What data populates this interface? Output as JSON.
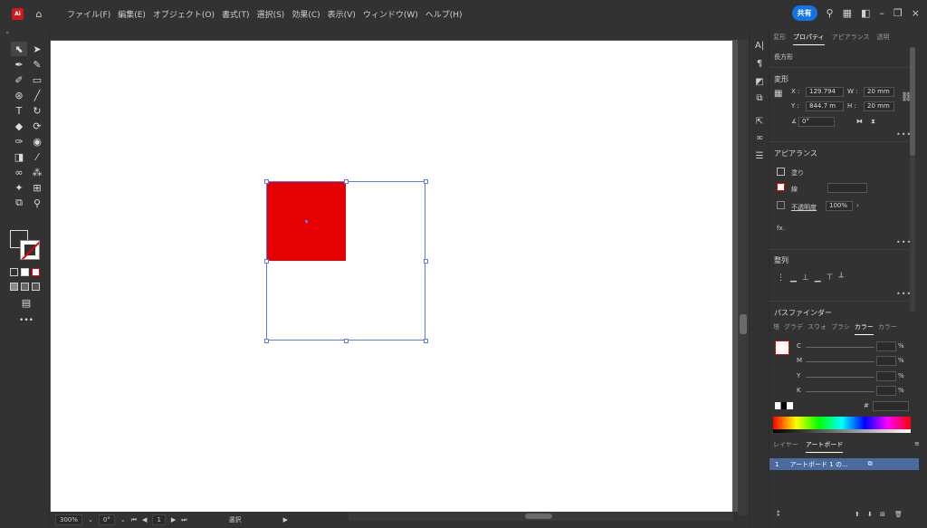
{
  "menu": {
    "logo": "Ai",
    "items": [
      "ファイル(F)",
      "編集(E)",
      "オブジェクト(O)",
      "書式(T)",
      "選択(S)",
      "効果(C)",
      "表示(V)",
      "ウィンドウ(W)",
      "ヘルプ(H)"
    ],
    "share_label": "共有"
  },
  "statusbar": {
    "zoom": "300%",
    "rotation": "0°",
    "artboard_index": "1",
    "tool_name": "選択"
  },
  "panel": {
    "tabs": [
      "変形",
      "プロパティ",
      "アピアランス",
      "透明"
    ],
    "active_tab": "プロパティ",
    "object_type": "長方形",
    "transform": {
      "title": "変形",
      "x_label": "X :",
      "x_value": "129.794",
      "y_label": "Y :",
      "y_value": "844.7 m",
      "w_label": "W :",
      "w_value": "20 mm",
      "h_label": "H :",
      "h_value": "20 mm",
      "angle_value": "0°"
    },
    "appearance": {
      "title": "アピアランス",
      "fill_label": "塗り",
      "stroke_label": "線",
      "opacity_label": "不透明度",
      "opacity_value": "100%",
      "fx_label": "fx."
    },
    "align": {
      "title": "整列"
    },
    "pathfinder": {
      "title": "パスファインダー"
    },
    "color_tabs": [
      "塔",
      "グラデ",
      "スウォ",
      "ブラシ",
      "カラー",
      "カラー"
    ],
    "color": {
      "c_label": "C",
      "m_label": "M",
      "y_label": "Y",
      "k_label": "K",
      "pct": "%",
      "hash": "#"
    },
    "layers_tabs": [
      "レイヤー",
      "アートボード"
    ],
    "artboard_row": {
      "index": "1",
      "name": "アートボード 1 の..."
    }
  },
  "colors": {
    "accent": "#1473e6",
    "selection": "#5b7ee8",
    "object_fill": "#e50101"
  }
}
